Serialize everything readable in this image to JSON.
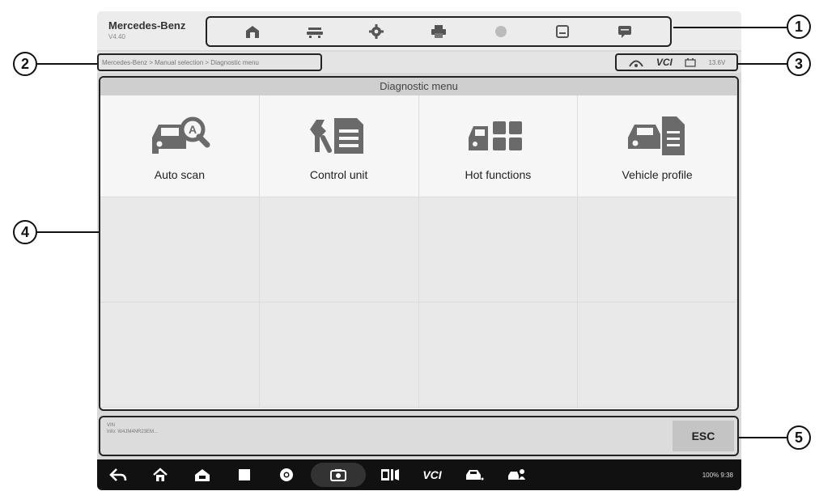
{
  "header": {
    "brand_title": "Mercedes-Benz",
    "brand_sub": "V4.40"
  },
  "toolbar": {
    "icons": [
      "home-icon",
      "car-lift-icon",
      "gear-icon",
      "printer-icon",
      "help-icon",
      "save-icon",
      "chat-icon"
    ]
  },
  "navbar": {
    "breadcrumb": "Mercedes-Benz > Manual selection > Diagnostic menu",
    "vci_label": "VCI",
    "voltage": "13.6V"
  },
  "main": {
    "title": "Diagnostic menu",
    "tiles": [
      {
        "label": "Auto scan",
        "icon": "car-scan-icon"
      },
      {
        "label": "Control unit",
        "icon": "control-unit-icon"
      },
      {
        "label": "Hot functions",
        "icon": "hot-functions-icon"
      },
      {
        "label": "Vehicle profile",
        "icon": "vehicle-profile-icon"
      }
    ]
  },
  "infobar": {
    "line1": "VIN",
    "line2": "Info: W4JM4NR23EM...",
    "esc_label": "ESC"
  },
  "sysbar": {
    "vci_label": "VCI",
    "status": "100% 9:38"
  },
  "callouts": [
    "1",
    "2",
    "3",
    "4",
    "5"
  ],
  "colors": {
    "frame": "#222222",
    "screen_bg": "#d9d9d9",
    "tile_bg": "#f6f6f6",
    "sysbar_bg": "#111111"
  }
}
